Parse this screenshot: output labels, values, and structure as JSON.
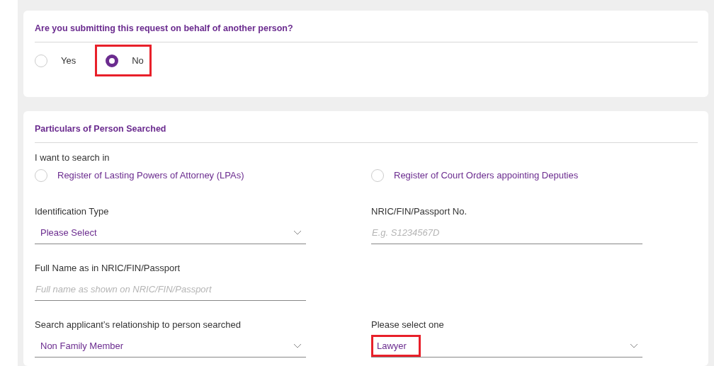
{
  "question_card": {
    "title": "Are you submitting this request on behalf of another person?",
    "options": [
      {
        "label": "Yes",
        "selected": false,
        "highlighted": false
      },
      {
        "label": "No",
        "selected": true,
        "highlighted": true
      }
    ]
  },
  "particulars_card": {
    "title": "Particulars of Person Searched",
    "search_in": {
      "label": "I want to search in",
      "options": [
        {
          "label": "Register of Lasting Powers of Attorney (LPAs)",
          "selected": false
        },
        {
          "label": "Register of Court Orders appointing Deputies",
          "selected": false
        }
      ]
    },
    "field_rows": [
      [
        {
          "kind": "select",
          "label": "Identification Type",
          "value": "Please Select",
          "highlighted": false
        },
        {
          "kind": "text",
          "label": "NRIC/FIN/Passport No.",
          "placeholder": "E.g. S1234567D"
        }
      ],
      [
        {
          "kind": "text",
          "label": "Full Name as in NRIC/FIN/Passport",
          "placeholder": "Full name as shown on NRIC/FIN/Passport"
        }
      ],
      [
        {
          "kind": "select",
          "label": "Search applicant’s relationship to person searched",
          "value": "Non Family Member",
          "highlighted": false
        },
        {
          "kind": "select",
          "label": "Please select one",
          "value": "Lawyer",
          "highlighted": true
        }
      ]
    ]
  }
}
